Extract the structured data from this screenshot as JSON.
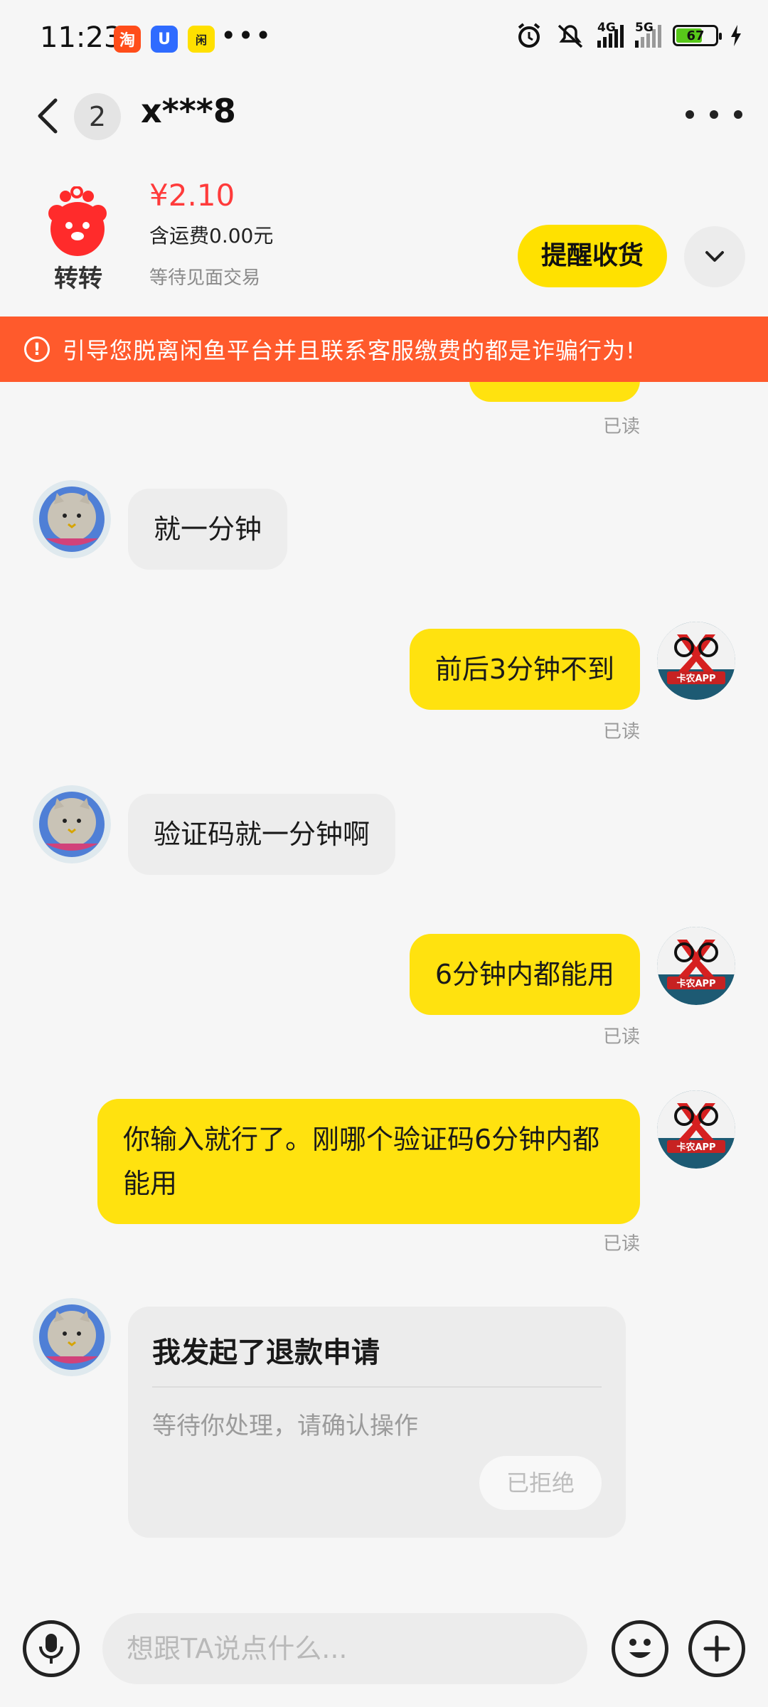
{
  "status_bar": {
    "time": "11:23",
    "dots": "•••",
    "battery": "67",
    "net1": "4G",
    "net2": "5G"
  },
  "header": {
    "unread_count": "2",
    "title": "x***8"
  },
  "order": {
    "platform_name": "转转",
    "price": "¥2.10",
    "shipping": "含运费0.00元",
    "trade_status": "等待见面交易",
    "remind_label": "提醒收货"
  },
  "warning": {
    "text": "引导您脱离闲鱼平台并且联系客服缴费的都是诈骗行为!"
  },
  "messages": [
    {
      "side": "out",
      "text": "",
      "read": "已读"
    },
    {
      "side": "in",
      "text": "就一分钟"
    },
    {
      "side": "out",
      "text": "前后3分钟不到",
      "read": "已读"
    },
    {
      "side": "in",
      "text": "验证码就一分钟啊"
    },
    {
      "side": "out",
      "text": "6分钟内都能用",
      "read": "已读"
    },
    {
      "side": "out",
      "text": "你输入就行了。刚哪个验证码6分钟内都能用",
      "read": "已读"
    }
  ],
  "refund": {
    "title": "我发起了退款申请",
    "description": "等待你处理，请确认操作",
    "status": "已拒绝"
  },
  "avatar_text": "卡农APP",
  "input": {
    "placeholder": "想跟TA说点什么..."
  }
}
